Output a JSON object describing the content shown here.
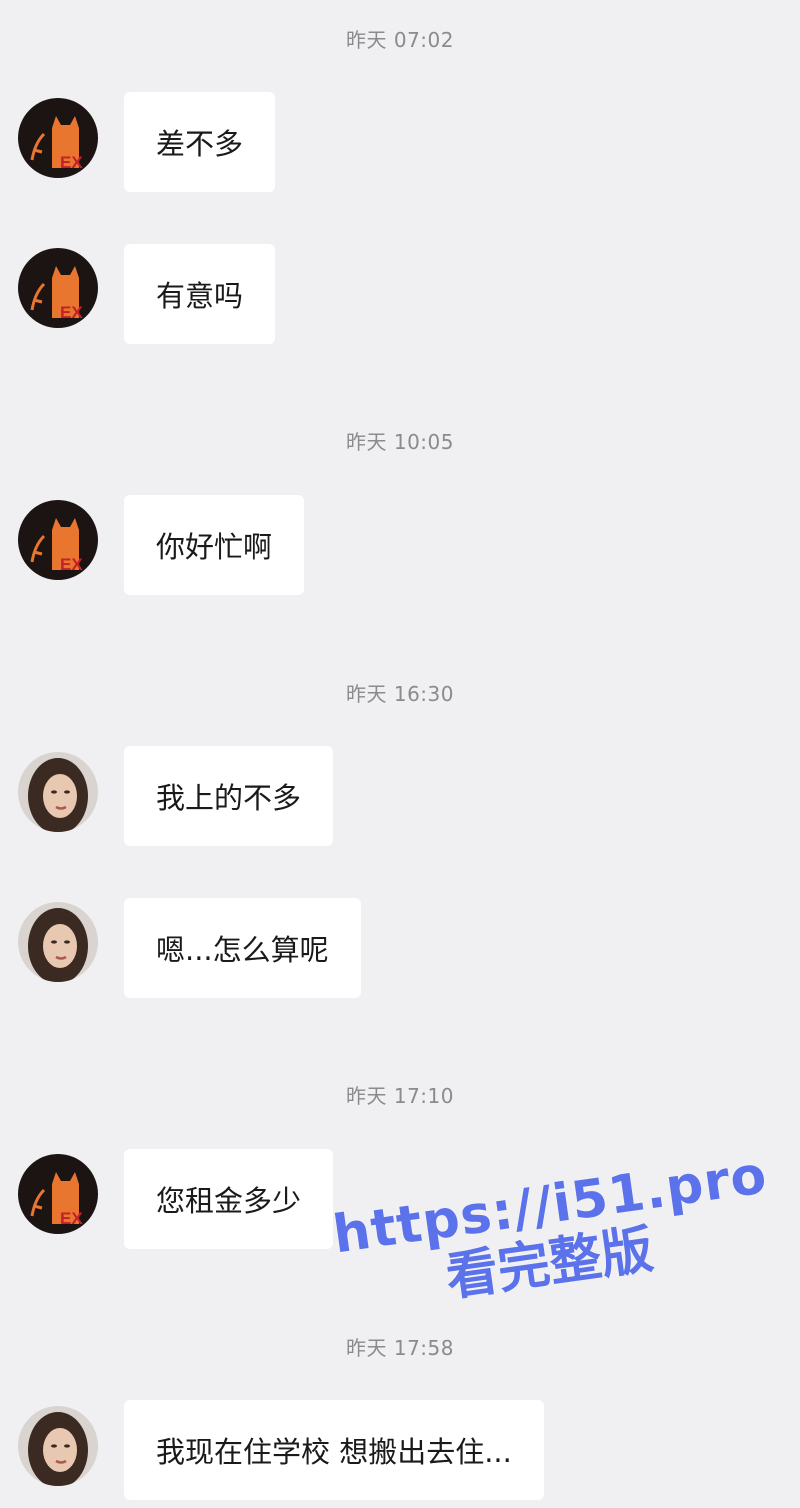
{
  "messages": [
    {
      "time": "昨天 07:02"
    },
    {
      "sender": "cat",
      "text": "差不多"
    },
    {
      "sender": "cat",
      "text": "有意吗"
    },
    {
      "time": "昨天 10:05"
    },
    {
      "sender": "cat",
      "text": "你好忙啊"
    },
    {
      "time": "昨天 16:30"
    },
    {
      "sender": "girl",
      "text": "我上的不多"
    },
    {
      "sender": "girl",
      "text": "嗯...怎么算呢"
    },
    {
      "time": "昨天 17:10"
    },
    {
      "sender": "cat",
      "text": "您租金多少"
    },
    {
      "time": "昨天 17:58"
    },
    {
      "sender": "girl",
      "text": "我现在住学校 想搬出去住..."
    }
  ],
  "avatars": {
    "cat": {
      "icon": "cat-ex-avatar-icon",
      "text": "EX",
      "bg": "#1c1412",
      "accent": "#e8762e"
    },
    "girl": {
      "icon": "girl-photo-avatar-icon",
      "hair": "#3a2a22",
      "skin": "#e8c8b0"
    }
  },
  "watermark": {
    "url": "https://i51.pro",
    "subtitle": "看完整版",
    "color": "#5b72ea"
  }
}
